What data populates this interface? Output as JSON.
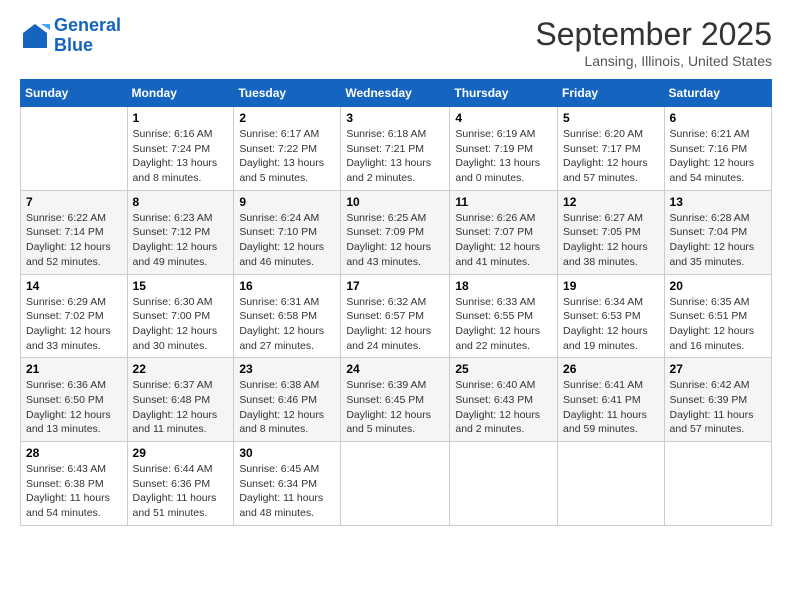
{
  "logo": {
    "line1": "General",
    "line2": "Blue"
  },
  "title": "September 2025",
  "location": "Lansing, Illinois, United States",
  "days_of_week": [
    "Sunday",
    "Monday",
    "Tuesday",
    "Wednesday",
    "Thursday",
    "Friday",
    "Saturday"
  ],
  "weeks": [
    [
      {
        "num": "",
        "info": ""
      },
      {
        "num": "1",
        "info": "Sunrise: 6:16 AM\nSunset: 7:24 PM\nDaylight: 13 hours\nand 8 minutes."
      },
      {
        "num": "2",
        "info": "Sunrise: 6:17 AM\nSunset: 7:22 PM\nDaylight: 13 hours\nand 5 minutes."
      },
      {
        "num": "3",
        "info": "Sunrise: 6:18 AM\nSunset: 7:21 PM\nDaylight: 13 hours\nand 2 minutes."
      },
      {
        "num": "4",
        "info": "Sunrise: 6:19 AM\nSunset: 7:19 PM\nDaylight: 13 hours\nand 0 minutes."
      },
      {
        "num": "5",
        "info": "Sunrise: 6:20 AM\nSunset: 7:17 PM\nDaylight: 12 hours\nand 57 minutes."
      },
      {
        "num": "6",
        "info": "Sunrise: 6:21 AM\nSunset: 7:16 PM\nDaylight: 12 hours\nand 54 minutes."
      }
    ],
    [
      {
        "num": "7",
        "info": "Sunrise: 6:22 AM\nSunset: 7:14 PM\nDaylight: 12 hours\nand 52 minutes."
      },
      {
        "num": "8",
        "info": "Sunrise: 6:23 AM\nSunset: 7:12 PM\nDaylight: 12 hours\nand 49 minutes."
      },
      {
        "num": "9",
        "info": "Sunrise: 6:24 AM\nSunset: 7:10 PM\nDaylight: 12 hours\nand 46 minutes."
      },
      {
        "num": "10",
        "info": "Sunrise: 6:25 AM\nSunset: 7:09 PM\nDaylight: 12 hours\nand 43 minutes."
      },
      {
        "num": "11",
        "info": "Sunrise: 6:26 AM\nSunset: 7:07 PM\nDaylight: 12 hours\nand 41 minutes."
      },
      {
        "num": "12",
        "info": "Sunrise: 6:27 AM\nSunset: 7:05 PM\nDaylight: 12 hours\nand 38 minutes."
      },
      {
        "num": "13",
        "info": "Sunrise: 6:28 AM\nSunset: 7:04 PM\nDaylight: 12 hours\nand 35 minutes."
      }
    ],
    [
      {
        "num": "14",
        "info": "Sunrise: 6:29 AM\nSunset: 7:02 PM\nDaylight: 12 hours\nand 33 minutes."
      },
      {
        "num": "15",
        "info": "Sunrise: 6:30 AM\nSunset: 7:00 PM\nDaylight: 12 hours\nand 30 minutes."
      },
      {
        "num": "16",
        "info": "Sunrise: 6:31 AM\nSunset: 6:58 PM\nDaylight: 12 hours\nand 27 minutes."
      },
      {
        "num": "17",
        "info": "Sunrise: 6:32 AM\nSunset: 6:57 PM\nDaylight: 12 hours\nand 24 minutes."
      },
      {
        "num": "18",
        "info": "Sunrise: 6:33 AM\nSunset: 6:55 PM\nDaylight: 12 hours\nand 22 minutes."
      },
      {
        "num": "19",
        "info": "Sunrise: 6:34 AM\nSunset: 6:53 PM\nDaylight: 12 hours\nand 19 minutes."
      },
      {
        "num": "20",
        "info": "Sunrise: 6:35 AM\nSunset: 6:51 PM\nDaylight: 12 hours\nand 16 minutes."
      }
    ],
    [
      {
        "num": "21",
        "info": "Sunrise: 6:36 AM\nSunset: 6:50 PM\nDaylight: 12 hours\nand 13 minutes."
      },
      {
        "num": "22",
        "info": "Sunrise: 6:37 AM\nSunset: 6:48 PM\nDaylight: 12 hours\nand 11 minutes."
      },
      {
        "num": "23",
        "info": "Sunrise: 6:38 AM\nSunset: 6:46 PM\nDaylight: 12 hours\nand 8 minutes."
      },
      {
        "num": "24",
        "info": "Sunrise: 6:39 AM\nSunset: 6:45 PM\nDaylight: 12 hours\nand 5 minutes."
      },
      {
        "num": "25",
        "info": "Sunrise: 6:40 AM\nSunset: 6:43 PM\nDaylight: 12 hours\nand 2 minutes."
      },
      {
        "num": "26",
        "info": "Sunrise: 6:41 AM\nSunset: 6:41 PM\nDaylight: 11 hours\nand 59 minutes."
      },
      {
        "num": "27",
        "info": "Sunrise: 6:42 AM\nSunset: 6:39 PM\nDaylight: 11 hours\nand 57 minutes."
      }
    ],
    [
      {
        "num": "28",
        "info": "Sunrise: 6:43 AM\nSunset: 6:38 PM\nDaylight: 11 hours\nand 54 minutes."
      },
      {
        "num": "29",
        "info": "Sunrise: 6:44 AM\nSunset: 6:36 PM\nDaylight: 11 hours\nand 51 minutes."
      },
      {
        "num": "30",
        "info": "Sunrise: 6:45 AM\nSunset: 6:34 PM\nDaylight: 11 hours\nand 48 minutes."
      },
      {
        "num": "",
        "info": ""
      },
      {
        "num": "",
        "info": ""
      },
      {
        "num": "",
        "info": ""
      },
      {
        "num": "",
        "info": ""
      }
    ]
  ]
}
